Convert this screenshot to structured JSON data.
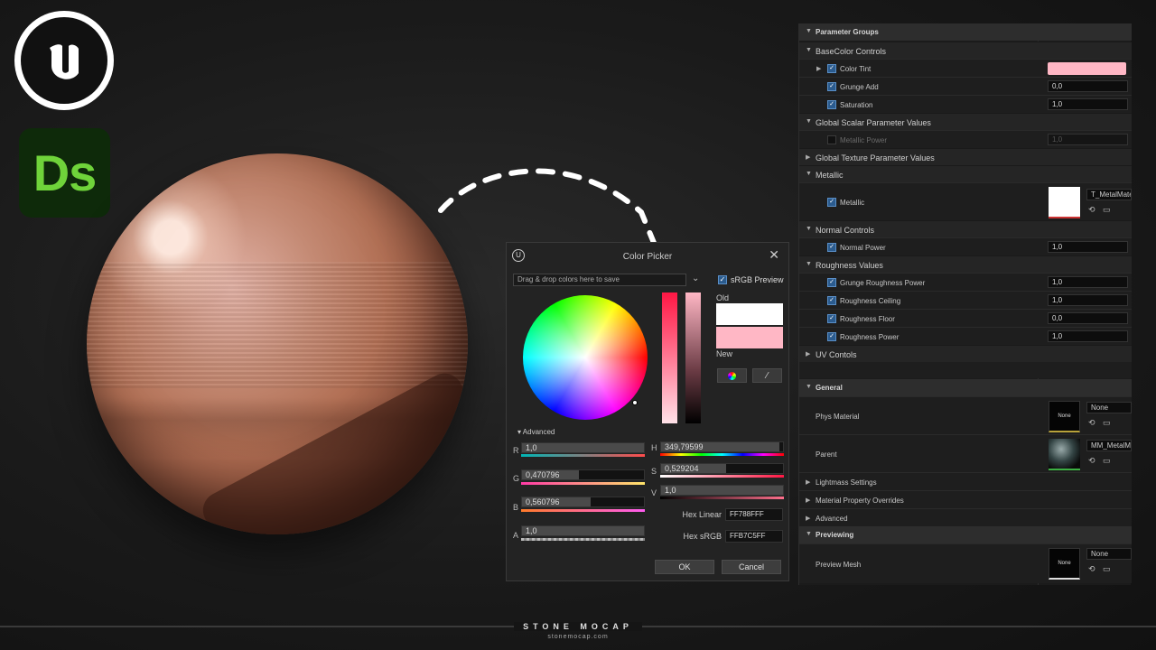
{
  "logos": {
    "ue_icon": "unreal-engine-logo",
    "ds_text": "Ds"
  },
  "picker": {
    "title": "Color Picker",
    "close": "✕",
    "swatch_placeholder": "Drag & drop colors here to save",
    "srgb_label": "sRGB Preview",
    "old_label": "Old",
    "new_label": "New",
    "old_color": "#ffffff",
    "new_color": "#ffb7c5",
    "advanced_label": "Advanced",
    "channels": {
      "r": {
        "label": "R",
        "value": "1,0"
      },
      "g": {
        "label": "G",
        "value": "0,470796",
        "fill": 0.47
      },
      "b": {
        "label": "B",
        "value": "0,560796",
        "fill": 0.56
      },
      "a": {
        "label": "A",
        "value": "1,0"
      },
      "h": {
        "label": "H",
        "value": "349,79599"
      },
      "s": {
        "label": "S",
        "value": "0,529204",
        "fill": 0.53
      },
      "v": {
        "label": "V",
        "value": "1,0"
      }
    },
    "hex_linear_label": "Hex Linear",
    "hex_linear_value": "FF788FFF",
    "hex_srgb_label": "Hex sRGB",
    "hex_srgb_value": "FFB7C5FF",
    "ok_label": "OK",
    "cancel_label": "Cancel"
  },
  "details": {
    "param_groups_header": "Parameter Groups",
    "basecolor_group": "BaseColor Controls",
    "color_tint_label": "Color Tint",
    "color_tint_value": "#ffb7c5",
    "grunge_add_label": "Grunge Add",
    "grunge_add_value": "0,0",
    "saturation_label": "Saturation",
    "saturation_value": "1,0",
    "global_scalar_group": "Global Scalar Parameter Values",
    "metallic_power_label": "Metallic Power",
    "metallic_power_value": "1,0",
    "global_texture_group": "Global Texture Parameter Values",
    "metallic_group": "Metallic",
    "metallic_label": "Metallic",
    "metallic_texture": "T_MetalMate",
    "normal_group": "Normal Controls",
    "normal_power_label": "Normal Power",
    "normal_power_value": "1,0",
    "roughness_group": "Roughness Values",
    "grunge_rough_label": "Grunge Roughness Power",
    "grunge_rough_value": "1,0",
    "rough_ceiling_label": "Roughness Ceiling",
    "rough_ceiling_value": "1,0",
    "rough_floor_label": "Roughness Floor",
    "rough_floor_value": "0,0",
    "rough_power_label": "Roughness Power",
    "rough_power_value": "1,0",
    "uv_group": "UV Contols",
    "general_header": "General",
    "phys_material_label": "Phys Material",
    "phys_material_thumb": "None",
    "phys_material_value": "None",
    "parent_label": "Parent",
    "parent_value": "MM_MetalMa",
    "lightmass_label": "Lightmass Settings",
    "mpo_label": "Material Property Overrides",
    "advanced_label": "Advanced",
    "previewing_header": "Previewing",
    "preview_mesh_label": "Preview Mesh",
    "preview_mesh_thumb": "None",
    "preview_mesh_value": "None"
  },
  "footer": {
    "brand": "STONE MOCAP",
    "url": "stonemocap.com"
  }
}
